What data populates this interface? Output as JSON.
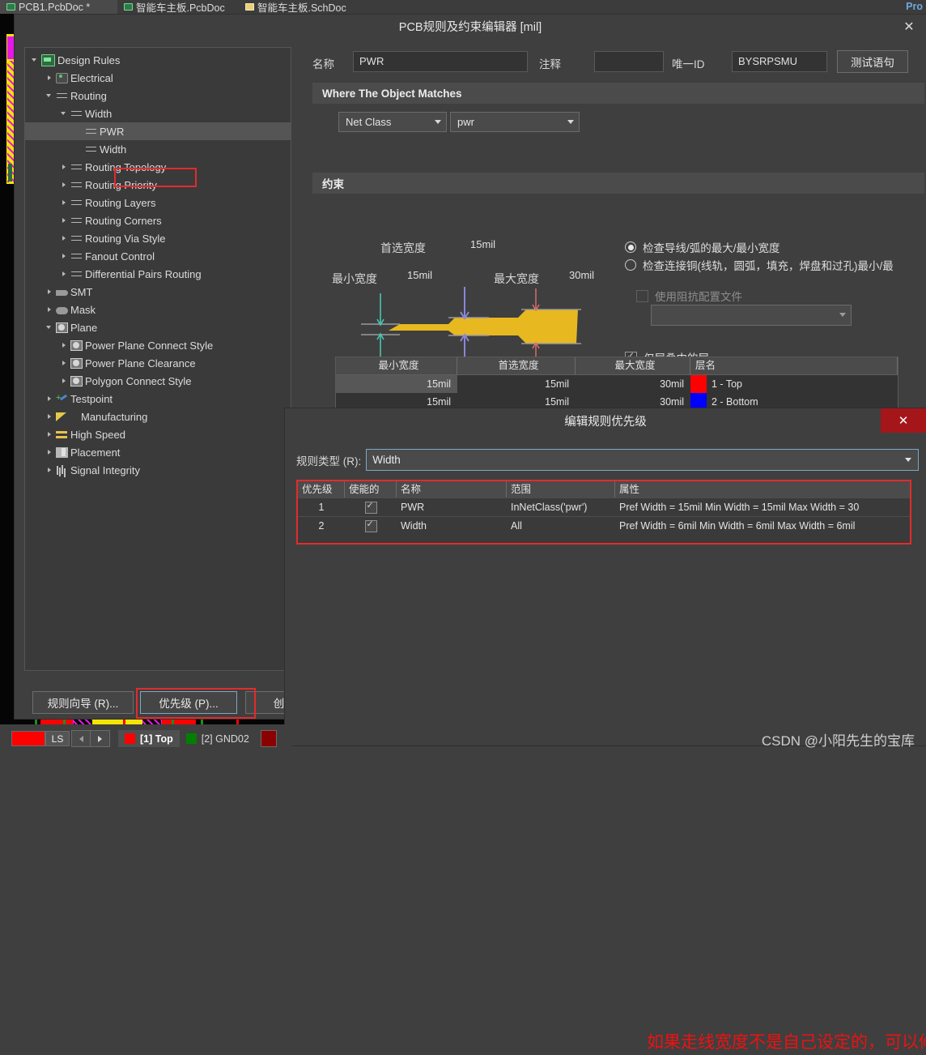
{
  "tabs": [
    {
      "label": "PCB1.PcbDoc *",
      "icon": "pcb-doc-icon",
      "active": true
    },
    {
      "label": "智能车主板.PcbDoc",
      "icon": "pcb-doc-icon",
      "active": false
    },
    {
      "label": "智能车主板.SchDoc",
      "icon": "sch-doc-icon",
      "active": false
    }
  ],
  "top_right_label": "Pro",
  "dialog": {
    "title": "PCB规则及约束编辑器 [mil]",
    "close_icon": "close-icon"
  },
  "tree": [
    {
      "label": "Design Rules",
      "indent": 0,
      "arrow": "down",
      "icon": "folder-rules-icon",
      "selected": false
    },
    {
      "label": "Electrical",
      "indent": 1,
      "arrow": "right",
      "icon": "electrical-icon",
      "selected": false
    },
    {
      "label": "Routing",
      "indent": 1,
      "arrow": "down",
      "icon": "routing-icon",
      "selected": false
    },
    {
      "label": "Width",
      "indent": 2,
      "arrow": "down",
      "icon": "routing-icon",
      "selected": false
    },
    {
      "label": "PWR",
      "indent": 3,
      "arrow": "none",
      "icon": "routing-icon",
      "selected": true
    },
    {
      "label": "Width",
      "indent": 3,
      "arrow": "none",
      "icon": "routing-icon",
      "selected": false
    },
    {
      "label": "Routing Topology",
      "indent": 2,
      "arrow": "right",
      "icon": "routing-icon",
      "selected": false
    },
    {
      "label": "Routing Priority",
      "indent": 2,
      "arrow": "right",
      "icon": "routing-icon",
      "selected": false
    },
    {
      "label": "Routing Layers",
      "indent": 2,
      "arrow": "right",
      "icon": "routing-icon",
      "selected": false
    },
    {
      "label": "Routing Corners",
      "indent": 2,
      "arrow": "right",
      "icon": "routing-icon",
      "selected": false
    },
    {
      "label": "Routing Via Style",
      "indent": 2,
      "arrow": "right",
      "icon": "routing-icon",
      "selected": false
    },
    {
      "label": "Fanout Control",
      "indent": 2,
      "arrow": "right",
      "icon": "routing-icon",
      "selected": false
    },
    {
      "label": "Differential Pairs Routing",
      "indent": 2,
      "arrow": "right",
      "icon": "routing-icon",
      "selected": false
    },
    {
      "label": "SMT",
      "indent": 1,
      "arrow": "right",
      "icon": "smt-icon",
      "selected": false
    },
    {
      "label": "Mask",
      "indent": 1,
      "arrow": "right",
      "icon": "mask-icon",
      "selected": false
    },
    {
      "label": "Plane",
      "indent": 1,
      "arrow": "down",
      "icon": "plane-icon",
      "selected": false
    },
    {
      "label": "Power Plane Connect Style",
      "indent": 2,
      "arrow": "right",
      "icon": "plane-icon",
      "selected": false
    },
    {
      "label": "Power Plane Clearance",
      "indent": 2,
      "arrow": "right",
      "icon": "plane-icon",
      "selected": false
    },
    {
      "label": "Polygon Connect Style",
      "indent": 2,
      "arrow": "right",
      "icon": "plane-icon",
      "selected": false
    },
    {
      "label": "Testpoint",
      "indent": 1,
      "arrow": "right",
      "icon": "testpoint-icon",
      "selected": false
    },
    {
      "label": "Manufacturing",
      "indent": 1,
      "arrow": "right",
      "icon": "manufacturing-icon",
      "selected": false
    },
    {
      "label": "High Speed",
      "indent": 1,
      "arrow": "right",
      "icon": "high-speed-icon",
      "selected": false
    },
    {
      "label": "Placement",
      "indent": 1,
      "arrow": "right",
      "icon": "placement-icon",
      "selected": false
    },
    {
      "label": "Signal Integrity",
      "indent": 1,
      "arrow": "right",
      "icon": "signal-integrity-icon",
      "selected": false
    }
  ],
  "form": {
    "name_label": "名称",
    "name_value": "PWR",
    "comment_label": "注释",
    "comment_value": "",
    "comment_placeholder": "",
    "uid_label": "唯一ID",
    "uid_value": "BYSRPSMU",
    "test_query_button": "测试语句"
  },
  "where_section": {
    "header": "Where The Object Matches",
    "scope_select": "Net Class",
    "scope_value_select": "pwr"
  },
  "constraints": {
    "header": "约束",
    "diagram": {
      "preferred_label": "首选宽度",
      "preferred_value": "15mil",
      "min_label": "最小宽度",
      "min_value": "15mil",
      "max_label": "最大宽度",
      "max_value": "30mil",
      "track_color": "#e8b820"
    },
    "options": [
      {
        "type": "radio",
        "label": "检查导线/弧的最大/最小宽度",
        "checked": true,
        "enabled": true
      },
      {
        "type": "radio",
        "label": "检查连接铜(线轨，圆弧，填充，焊盘和过孔)最小/最",
        "checked": false,
        "enabled": true
      },
      {
        "type": "checkbox",
        "label": "使用阻抗配置文件",
        "checked": false,
        "enabled": false
      },
      {
        "type": "checkbox",
        "label": "仅层叠中的层",
        "checked": true,
        "enabled": true
      }
    ],
    "impedance_profile_value": "",
    "table": {
      "columns": [
        "最小宽度",
        "首选宽度",
        "最大宽度",
        "层名"
      ],
      "rows": [
        {
          "min": "15mil",
          "pref": "15mil",
          "max": "30mil",
          "layer": "1 - Top",
          "color": "#ff0000",
          "selected": true
        },
        {
          "min": "15mil",
          "pref": "15mil",
          "max": "30mil",
          "layer": "2 - Bottom",
          "color": "#0000ff",
          "selected": false
        }
      ]
    }
  },
  "priority_dialog": {
    "title": "编辑规则优先级",
    "close_icon": "close-icon",
    "rule_type_label": "规则类型 (R):",
    "rule_type_value": "Width",
    "columns": [
      "优先级",
      "使能的",
      "名称",
      "范围",
      "属性"
    ],
    "rows": [
      {
        "priority": "1",
        "enabled": true,
        "name": "PWR",
        "scope": "InNetClass('pwr')",
        "attr": "Pref Width = 15mil    Min Width = 15mil    Max Width = 30"
      },
      {
        "priority": "2",
        "enabled": true,
        "name": "Width",
        "scope": "All",
        "attr": "Pref Width = 6mil    Min Width = 6mil    Max Width = 6mil"
      }
    ],
    "annotation": "如果走线宽度不是自己设定的，可以修改下走线的优先级",
    "annotation_color": "#ee1111"
  },
  "buttons": {
    "rule_wizard": "规则向导 (R)...",
    "priority": "优先级 (P)...",
    "create": "创建黑"
  },
  "status_bar": {
    "color_swatch": "#ff0000",
    "ls_label": "LS",
    "prev_icon": "chevron-left-icon",
    "next_icon": "chevron-right-icon",
    "layers": [
      {
        "label": "[1] Top",
        "color": "#ff0000",
        "active": true
      },
      {
        "label": "[2] GND02",
        "color": "#008000",
        "active": false
      }
    ],
    "extra_swatch": "#8b0000"
  },
  "watermark": "CSDN @小阳先生的宝库"
}
